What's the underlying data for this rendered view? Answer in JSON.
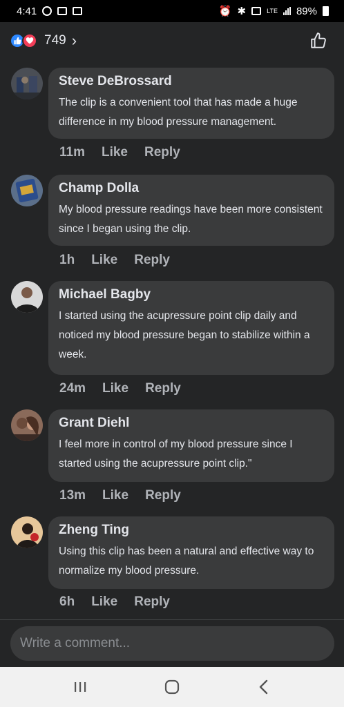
{
  "status_bar": {
    "time": "4:41",
    "battery": "89%",
    "network": "LTE"
  },
  "reactions": {
    "count": "749",
    "chevron": "›"
  },
  "comments": [
    {
      "name": "Steve DeBrossard",
      "text": "The clip is a convenient tool that has made a huge difference in my blood pressure management.",
      "time": "11m",
      "like": "Like",
      "reply": "Reply"
    },
    {
      "name": "Champ Dolla",
      "text": "My blood pressure readings have been more consistent since I began using the clip.",
      "time": "1h",
      "like": "Like",
      "reply": "Reply"
    },
    {
      "name": "Michael Bagby",
      "text": "I started using the acupressure point clip daily and noticed my blood pressure began to stabilize within a week.",
      "time": "24m",
      "like": "Like",
      "reply": "Reply"
    },
    {
      "name": "Grant Diehl",
      "text": "I feel more in control of my blood pressure since I started using the acupressure point clip.\"",
      "time": "13m",
      "like": "Like",
      "reply": "Reply"
    },
    {
      "name": "Zheng Ting",
      "text": "Using this clip has been a natural and effective way to normalize my blood pressure.",
      "time": "6h",
      "like": "Like",
      "reply": "Reply"
    }
  ],
  "composer": {
    "placeholder": "Write a comment..."
  },
  "colors": {
    "background": "#242526",
    "bubble": "#3a3b3c",
    "like_blue": "#2d88ff",
    "love_red": "#f33e58"
  }
}
